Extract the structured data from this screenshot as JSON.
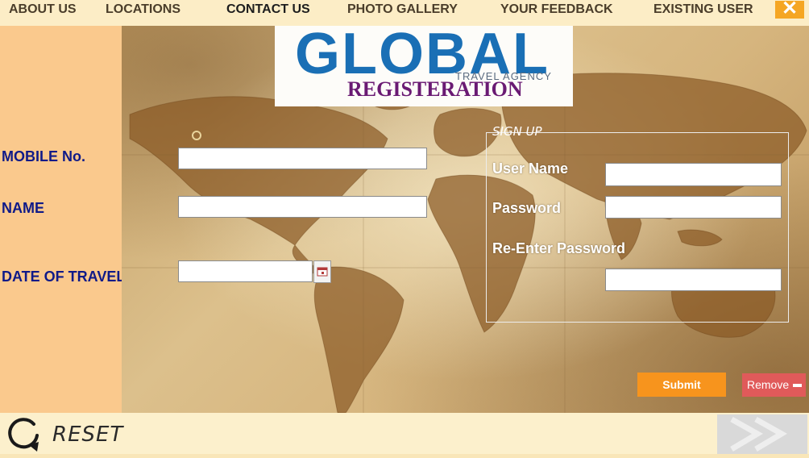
{
  "menu": {
    "about": "ABOUT US",
    "locations": "LOCATIONS",
    "contact": "CONTACT US",
    "gallery": "PHOTO GALLERY",
    "feedback": "YOUR FEEDBACK",
    "existing_user": "EXISTING USER",
    "close_icon": "close-icon"
  },
  "logo": {
    "brand": "GLOBAL",
    "tagline": "TRAVEL AGENCY",
    "title": "REGISTERATION"
  },
  "form": {
    "mobile_label": "MOBILE No.",
    "name_label": "NAME",
    "date_label": "DATE OF TRAVEL",
    "mobile_value": "",
    "name_value": "",
    "date_value": ""
  },
  "signup": {
    "legend": "SIGN UP",
    "username_label": "User Name",
    "password_label": "Password",
    "reenter_label": "Re-Enter Password",
    "username_value": "",
    "password_value": "",
    "reenter_value": ""
  },
  "buttons": {
    "submit": "Submit",
    "remove": "Remove"
  },
  "footer": {
    "reset": "RESET"
  },
  "colors": {
    "label_blue": "#0f1a88",
    "title_purple": "#6a1a73",
    "submit_orange": "#f7941d",
    "remove_red": "#e05a5a"
  }
}
